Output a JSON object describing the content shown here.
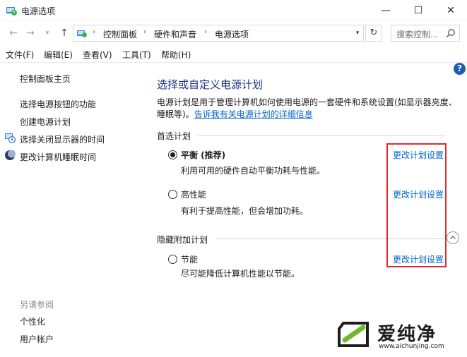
{
  "window": {
    "title": "电源选项",
    "minimize_glyph": "—",
    "maximize_glyph": "☐",
    "close_glyph": "✕"
  },
  "nav": {
    "back_glyph": "←",
    "forward_glyph": "→",
    "dropdown_glyph": "▾",
    "up_glyph": "↑",
    "breadcrumbs": [
      "控制面板",
      "硬件和声音",
      "电源选项"
    ],
    "separator": "›",
    "refresh_glyph": "↻",
    "search_placeholder": "搜索控制..."
  },
  "menu": [
    "文件(F)",
    "编辑(E)",
    "查看(V)",
    "工具(T)",
    "帮助(H)"
  ],
  "help_label": "?",
  "left_pane": {
    "home_link": "控制面板主页",
    "links": [
      {
        "label": "选择电源按钮的功能",
        "icon": "none"
      },
      {
        "label": "创建电源计划",
        "icon": "none"
      },
      {
        "label": "选择关闭显示器的时间",
        "icon": "display-clock-icon"
      },
      {
        "label": "更改计算机睡眠时间",
        "icon": "moon-icon"
      }
    ],
    "see_also_label": "另请参阅",
    "see_also_links": [
      "个性化",
      "用户帐户"
    ]
  },
  "main": {
    "heading": "选择或自定义电源计划",
    "desc_text": "电源计划是用于管理计算机如何使用电源的一套硬件和系统设置(如显示器亮度、睡眠等)。",
    "desc_link": "告诉我有关电源计划的详细信息",
    "preferred_label": "首选计划",
    "hidden_label": "隐藏附加计划",
    "plans": [
      {
        "name": "平衡 (推荐)",
        "desc": "利用可用的硬件自动平衡功耗与性能。",
        "checked": true,
        "link": "更改计划设置"
      },
      {
        "name": "高性能",
        "desc": "有利于提高性能，但会增加功耗。",
        "checked": false,
        "link": "更改计划设置"
      },
      {
        "name": "节能",
        "desc": "尽可能降低计算机性能以节能。",
        "checked": false,
        "link": "更改计划设置"
      }
    ]
  },
  "colors": {
    "heading": "#1e3287",
    "link": "#0066cc",
    "highlight_box": "#e02b2b",
    "help_badge": "#1c5fb1",
    "watermark_green": "#6fba2c"
  },
  "watermark": {
    "brand": "爱纯净",
    "url": "www.aichunjing.com"
  }
}
